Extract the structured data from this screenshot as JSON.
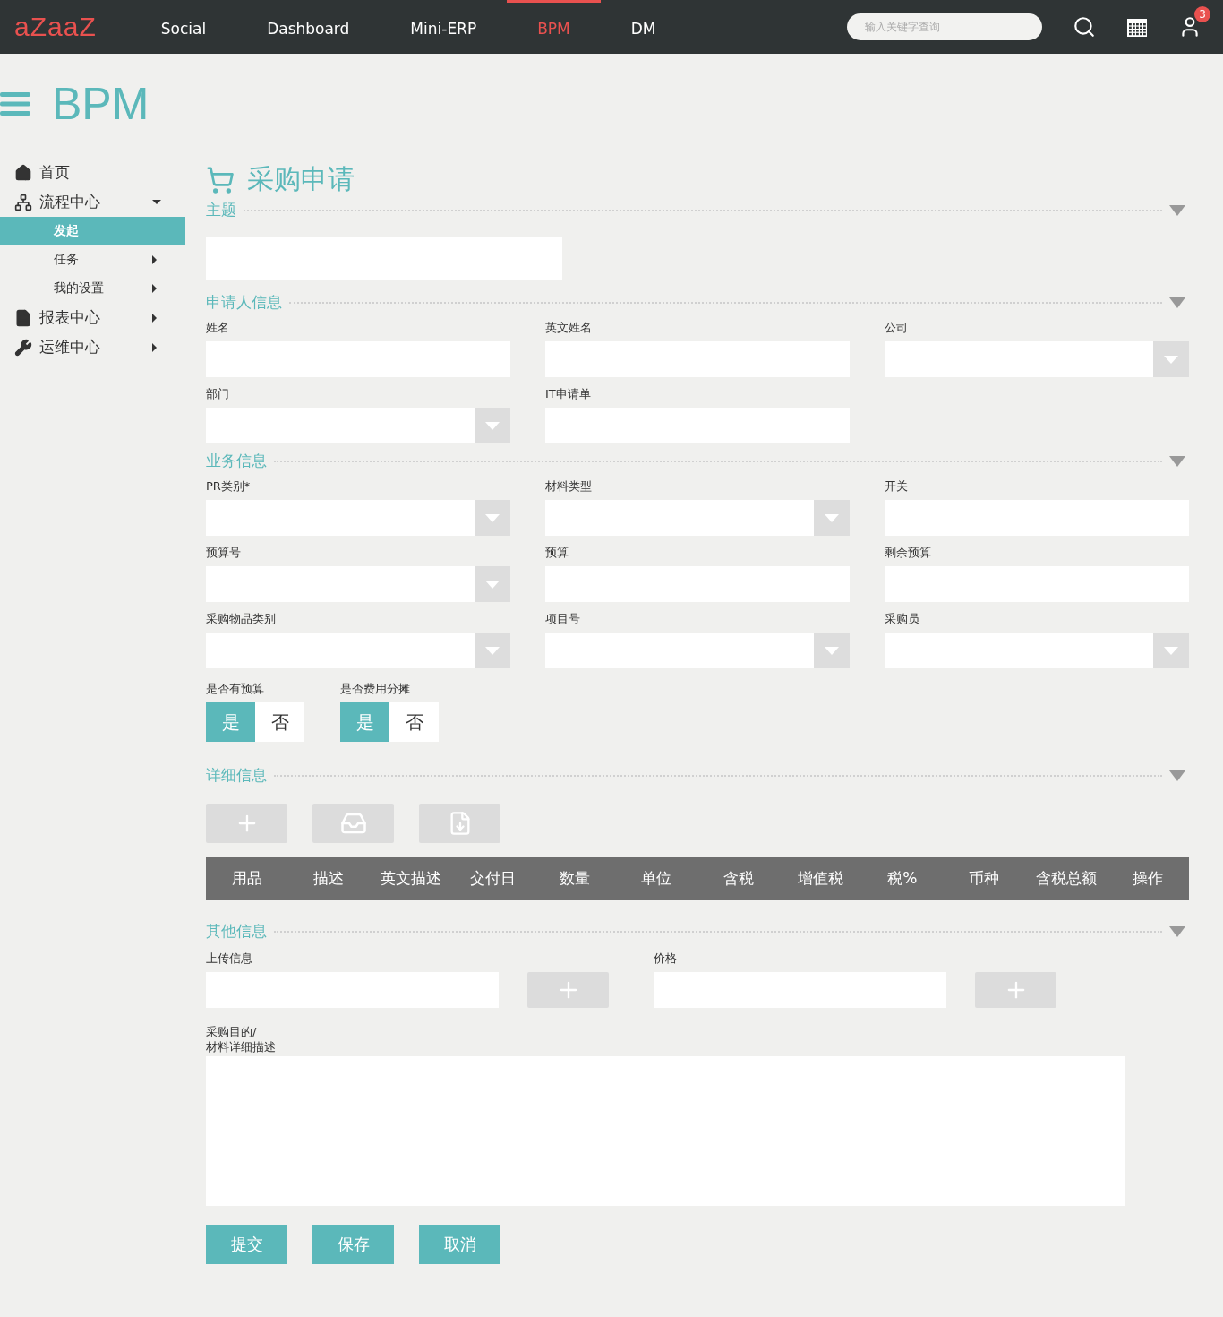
{
  "topbar": {
    "logo": "aZaaZ",
    "items": [
      {
        "label": "Social",
        "selected": false
      },
      {
        "label": "Dashboard",
        "selected": false
      },
      {
        "label": "Mini-ERP",
        "selected": false
      },
      {
        "label": "BPM",
        "selected": true
      },
      {
        "label": "DM",
        "selected": false
      }
    ],
    "search": {
      "placeholder": "输入关键字查询"
    },
    "notification_count": "3"
  },
  "page_title": "BPM",
  "sidebar": {
    "items": [
      {
        "label": "首页"
      },
      {
        "label": "流程中心",
        "expanded": true,
        "children": [
          {
            "label": "发起",
            "selected": true
          },
          {
            "label": "任务",
            "selected": false,
            "expanded": false
          },
          {
            "label": "我的设置",
            "selected": false,
            "expanded": false
          }
        ]
      },
      {
        "label": "报表中心",
        "expanded": false
      },
      {
        "label": "运维中心",
        "expanded": false
      }
    ]
  },
  "form": {
    "title": "采购申请",
    "subject": {
      "title": "主题"
    },
    "applicant": {
      "title": "申请人信息",
      "rows": [
        [
          {
            "label": "姓名",
            "kind": "text"
          },
          {
            "label": "英文姓名",
            "kind": "text"
          },
          {
            "label": "公司",
            "kind": "select"
          }
        ],
        [
          {
            "label": "部门",
            "kind": "select"
          },
          {
            "label": "IT申请单",
            "kind": "text"
          }
        ]
      ]
    },
    "business": {
      "title": "业务信息",
      "rows": [
        [
          {
            "label": "PR类别*",
            "kind": "select"
          },
          {
            "label": "材料类型",
            "kind": "select"
          },
          {
            "label": "开关",
            "kind": "text"
          }
        ],
        [
          {
            "label": "预算号",
            "kind": "select"
          },
          {
            "label": "预算",
            "kind": "text"
          },
          {
            "label": "剩余预算",
            "kind": "text"
          }
        ],
        [
          {
            "label": "采购物品类别",
            "kind": "select"
          },
          {
            "label": "项目号",
            "kind": "select"
          },
          {
            "label": "采购员",
            "kind": "select"
          }
        ]
      ],
      "toggles": [
        {
          "label": "是否有预算",
          "options": [
            {
              "label": "是",
              "selected": true
            },
            {
              "label": "否",
              "selected": false
            }
          ]
        },
        {
          "label": "是否费用分摊",
          "options": [
            {
              "label": "是",
              "selected": true
            },
            {
              "label": "否",
              "selected": false
            }
          ]
        }
      ]
    },
    "details": {
      "title": "详细信息",
      "columns": [
        "用品",
        "描述",
        "英文描述",
        "交付日",
        "数量",
        "单位",
        "含税",
        "增值税",
        "税%",
        "币种",
        "含税总额",
        "操作"
      ]
    },
    "other": {
      "title": "其他信息",
      "fields": [
        {
          "label": "上传信息"
        },
        {
          "label": "价格"
        }
      ],
      "textarea_label": [
        "采购目的/",
        "材料详细描述"
      ]
    },
    "actions": [
      "提交",
      "保存",
      "取消"
    ]
  }
}
